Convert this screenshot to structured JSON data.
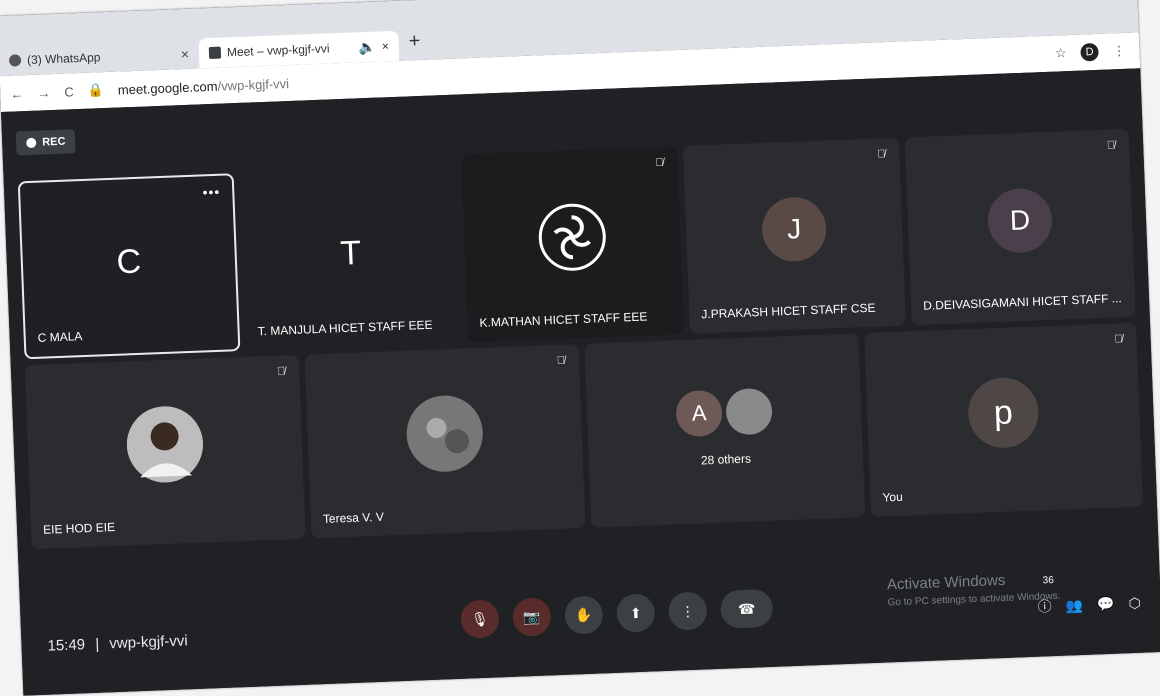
{
  "browser": {
    "tabs": [
      {
        "label": "(3) WhatsApp",
        "close": "×"
      },
      {
        "label": "Meet – vwp-kgjf-vvi",
        "audio": "🔈",
        "close": "×"
      }
    ],
    "new_tab": "+",
    "url": {
      "host": "meet.google.com",
      "path": "/vwp-kgjf-vvi"
    },
    "profile_initial": "D",
    "window_close": "×",
    "window_min": "–",
    "window_restore": "❐"
  },
  "meet": {
    "rec_label": "REC",
    "tiles": [
      {
        "name": "C MALA",
        "letter": "C"
      },
      {
        "name": "T. MANJULA HICET STAFF EEE",
        "letter": "T"
      },
      {
        "name": "K.MATHAN HICET STAFF EEE"
      },
      {
        "name": "J.PRAKASH HICET STAFF CSE",
        "letter": "J"
      },
      {
        "name": "D.DEIVASIGAMANI HICET STAFF ...",
        "letter": "D"
      },
      {
        "name": "EIE HOD EIE"
      },
      {
        "name": "Teresa V. V"
      },
      {
        "name": "28 others",
        "letter": "A"
      },
      {
        "name": "You",
        "letter": "p"
      }
    ],
    "more_dots": "•••",
    "clock": "15:49",
    "separator": "|",
    "meeting_code": "vwp-kgjf-vvi",
    "participant_count": "36",
    "watermark_title": "Activate Windows",
    "watermark_sub": "Go to PC settings to activate Windows."
  }
}
